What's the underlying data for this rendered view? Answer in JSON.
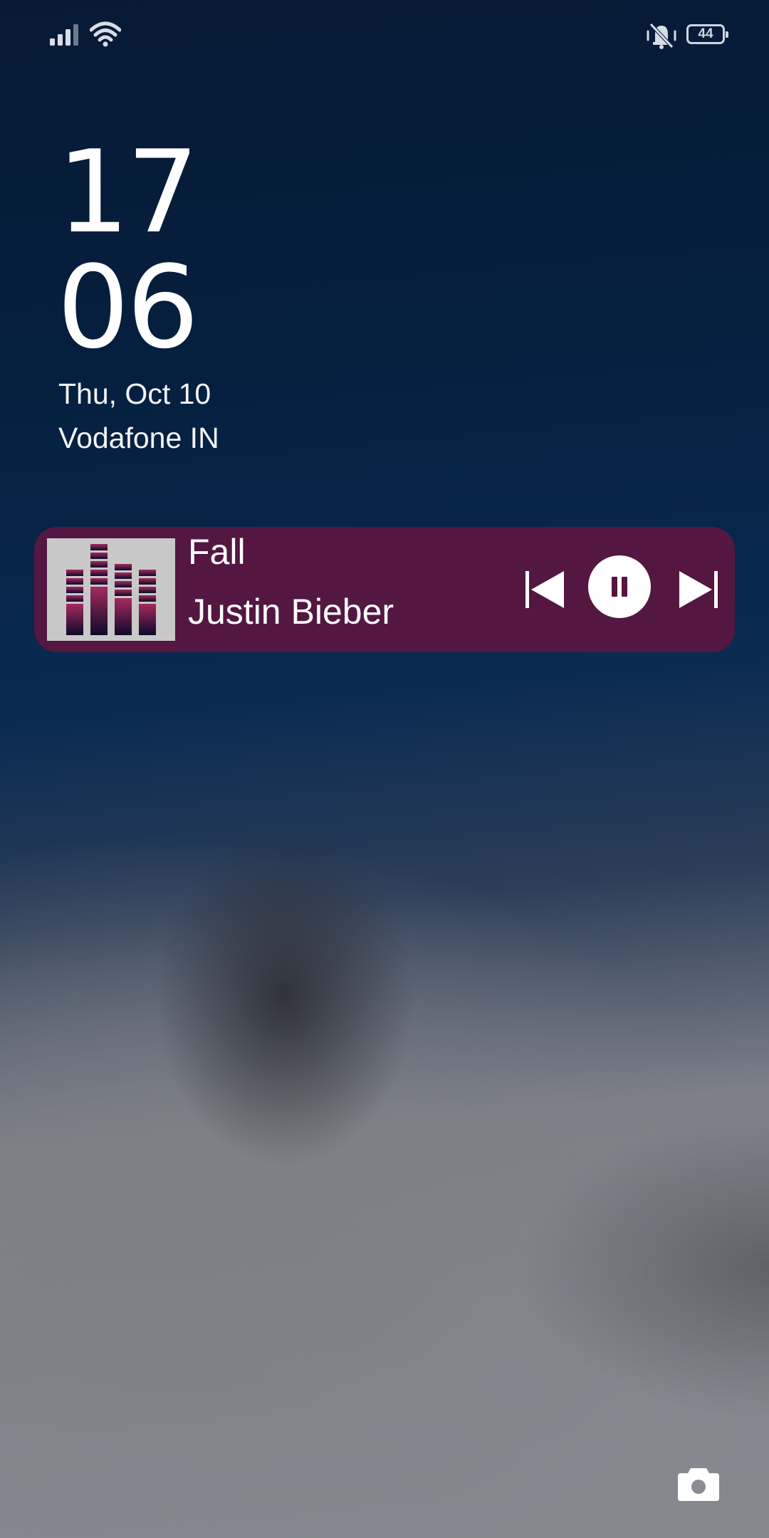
{
  "status_bar": {
    "battery_level": "44",
    "icons": [
      "signal-icon",
      "wifi-icon",
      "vibrate-icon",
      "battery-icon"
    ]
  },
  "lockscreen": {
    "hours": "17",
    "minutes": "06",
    "date": "Thu, Oct 10",
    "carrier": "Vodafone IN"
  },
  "media": {
    "title": "Fall",
    "artist": "Justin Bieber",
    "card_color": "#531741",
    "controls": [
      "prev-icon",
      "pause-icon",
      "next-icon"
    ]
  },
  "shortcut": {
    "icon": "camera-icon"
  }
}
